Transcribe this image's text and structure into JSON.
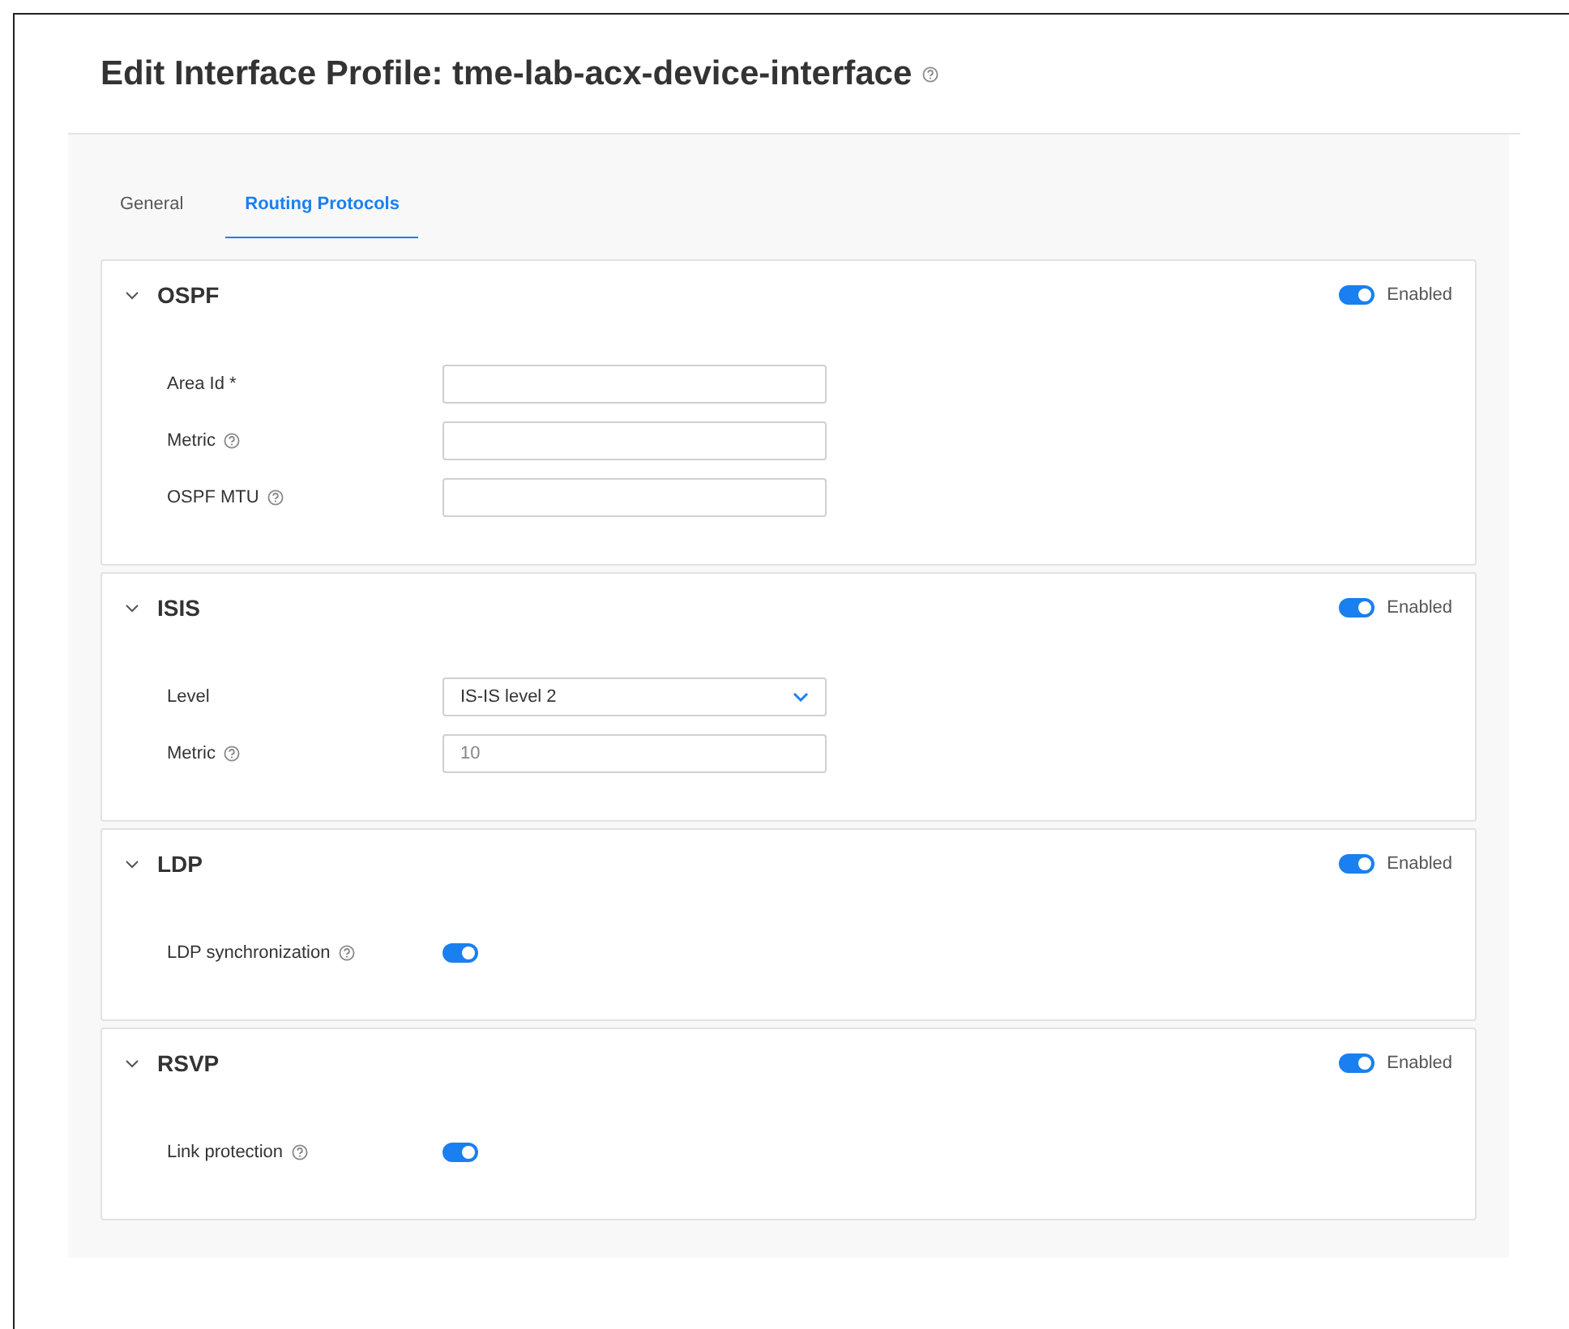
{
  "title": "Edit Interface Profile: tme-lab-acx-device-interface",
  "tabs": [
    {
      "label": "General",
      "selected": false
    },
    {
      "label": "Routing Protocols",
      "selected": true
    }
  ],
  "sections": [
    {
      "title": "OSPF",
      "expanded": true,
      "enabled": true,
      "enabled_label": "Enabled",
      "fields": [
        {
          "kind": "input",
          "label": "Area Id *",
          "help": false
        },
        {
          "kind": "input",
          "label": "Metric",
          "help": true
        },
        {
          "kind": "input",
          "label": "OSPF MTU",
          "help": true
        }
      ]
    },
    {
      "title": "ISIS",
      "expanded": true,
      "enabled": true,
      "enabled_label": "Enabled",
      "fields": [
        {
          "kind": "select",
          "label": "Level",
          "help": false,
          "value": "IS-IS level 2"
        },
        {
          "kind": "input",
          "label": "Metric",
          "help": true,
          "placeholder": "10"
        }
      ]
    },
    {
      "title": "LDP",
      "expanded": true,
      "enabled": true,
      "enabled_label": "Enabled",
      "fields": [
        {
          "kind": "toggle",
          "label": "LDP synchronization",
          "help": true,
          "on": true
        }
      ]
    },
    {
      "title": "RSVP",
      "expanded": true,
      "enabled": true,
      "enabled_label": "Enabled",
      "fields": [
        {
          "kind": "toggle",
          "label": "Link protection",
          "help": true,
          "on": true
        }
      ]
    }
  ]
}
